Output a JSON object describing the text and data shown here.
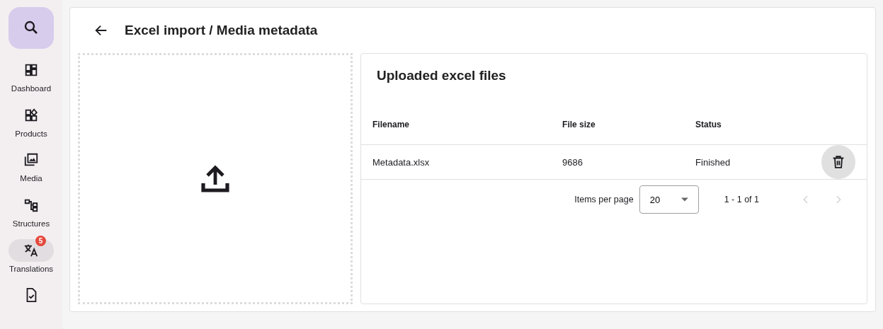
{
  "sidebar": {
    "items": [
      {
        "label": "Dashboard",
        "selected": false
      },
      {
        "label": "Products",
        "selected": false
      },
      {
        "label": "Media",
        "selected": false
      },
      {
        "label": "Structures",
        "selected": false
      },
      {
        "label": "Translations",
        "selected": true,
        "badge": "5"
      },
      {
        "selected": false
      }
    ]
  },
  "header": {
    "title": "Excel import / Media metadata"
  },
  "files": {
    "title": "Uploaded excel files",
    "columns": [
      "Filename",
      "File size",
      "Status"
    ],
    "rows": [
      {
        "cells": [
          "Metadata.xlsx",
          "9686",
          "Finished"
        ]
      }
    ],
    "paginator": {
      "label": "Items per page",
      "page_size": "20",
      "range": "1 - 1 of 1",
      "prev_disabled": true,
      "next_disabled": true
    }
  }
}
